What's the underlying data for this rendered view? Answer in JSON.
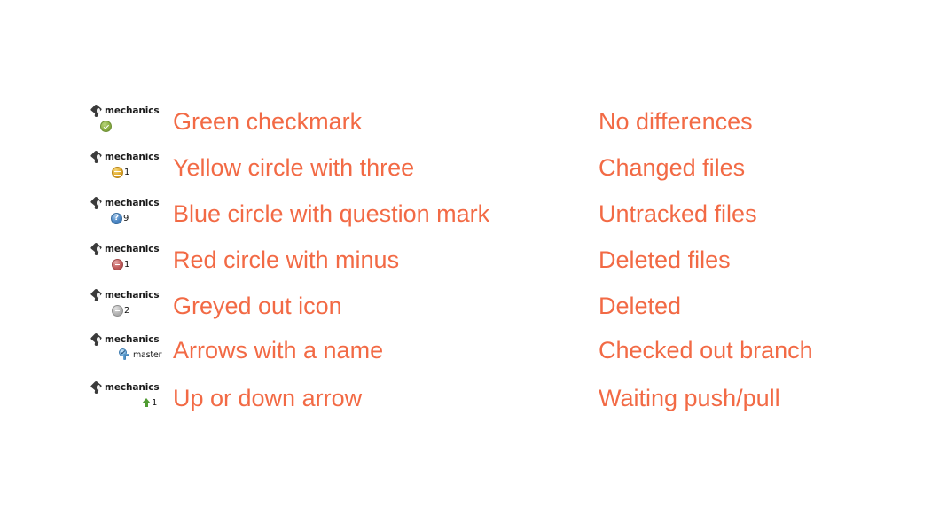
{
  "page": {
    "title": "Repository status icon legend",
    "background_color": "#ffffff",
    "text_color": "#f26a45"
  },
  "rows": [
    {
      "repo_name": "mechanics",
      "icon_name": "green-checkmark-badge",
      "badge_count": "",
      "description": "Green checkmark",
      "meaning": "No differences"
    },
    {
      "repo_name": "mechanics",
      "icon_name": "yellow-circle-badge",
      "badge_count": "1",
      "description": "Yellow circle with three",
      "meaning": "Changed files"
    },
    {
      "repo_name": "mechanics",
      "icon_name": "blue-question-mark-badge",
      "badge_count": "9",
      "description": "Blue circle with question mark",
      "meaning": "Untracked files"
    },
    {
      "repo_name": "mechanics",
      "icon_name": "red-minus-badge",
      "badge_count": "1",
      "description": "Red circle with minus",
      "meaning": "Deleted files"
    },
    {
      "repo_name": "mechanics",
      "icon_name": "grey-minus-badge",
      "badge_count": "2",
      "description": "Greyed out icon",
      "meaning": "Deleted"
    },
    {
      "repo_name": "mechanics",
      "icon_name": "branch-arrows-badge",
      "badge_count": "master",
      "description": "Arrows with a name",
      "meaning": "Checked out branch"
    },
    {
      "repo_name": "mechanics",
      "icon_name": "green-up-arrow-badge",
      "badge_count": "1",
      "description": "Up or down arrow",
      "meaning": "Waiting push/pull"
    }
  ],
  "badge_colors": {
    "green": "#8cb043",
    "yellow": "#e0a828",
    "blue": "#4b86c4",
    "red": "#c25d5d",
    "grey": "#b4b4b4",
    "branch_blue": "#4b8cc0",
    "arrow_green": "#4f9b32"
  }
}
